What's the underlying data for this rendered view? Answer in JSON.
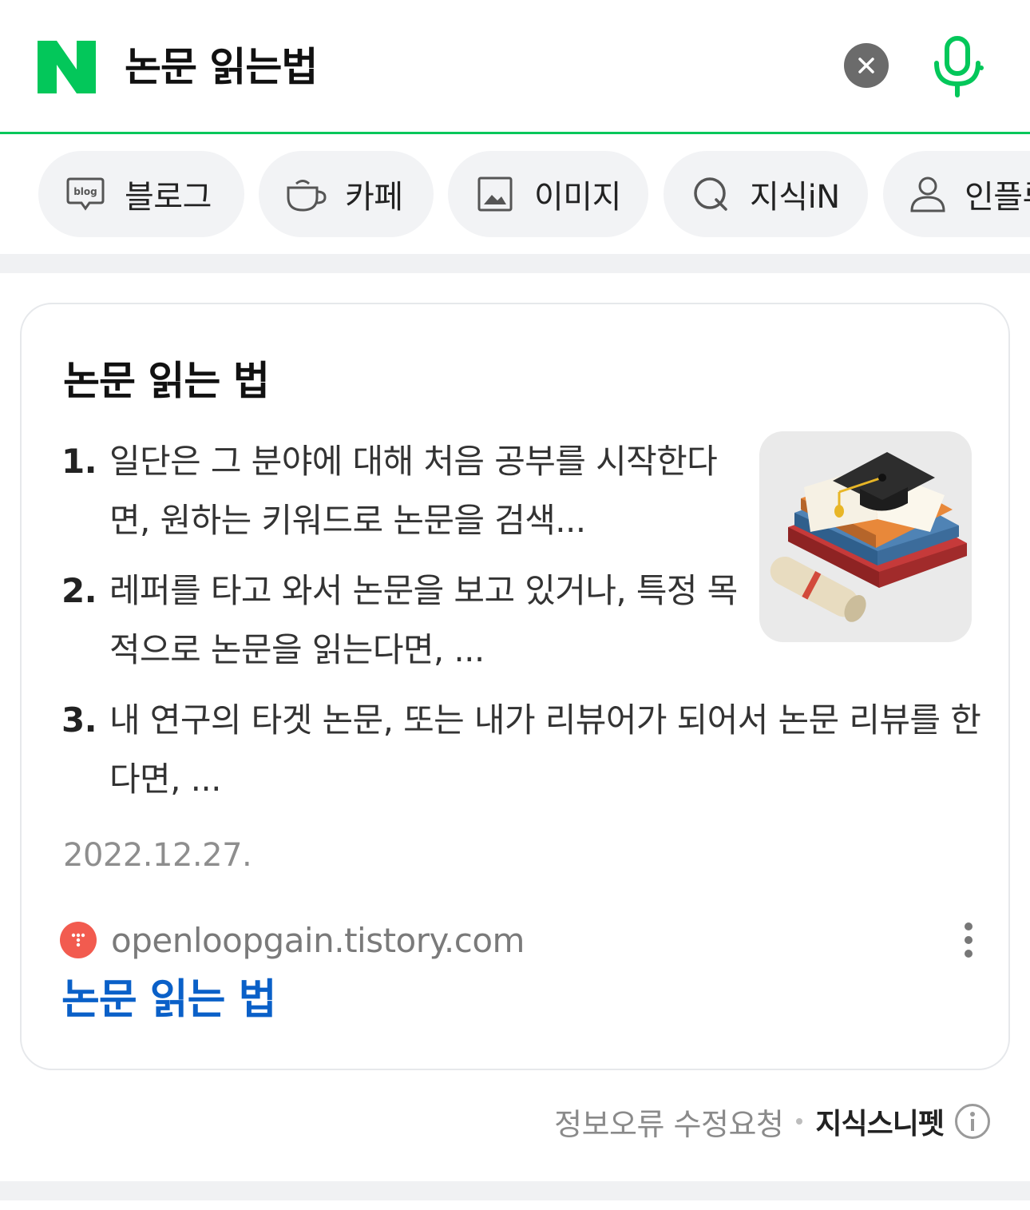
{
  "search": {
    "query": "논문 읽는법"
  },
  "tabs": [
    {
      "label": "블로그",
      "icon": "blog-icon"
    },
    {
      "label": "카페",
      "icon": "cup-icon"
    },
    {
      "label": "이미지",
      "icon": "image-icon"
    },
    {
      "label": "지식iN",
      "icon": "q-icon"
    },
    {
      "label": "인플루언서",
      "icon": "person-icon"
    }
  ],
  "card": {
    "title": "논문 읽는 법",
    "items": [
      {
        "num": "1.",
        "text": "일단은 그 분야에 대해 처음 공부를 시작한다면, 원하는 키워드로 논문을 검색..."
      },
      {
        "num": "2.",
        "text": "레퍼를 타고 와서 논문을 보고 있거나, 특정 목적으로 논문을 읽는다면, ..."
      },
      {
        "num": "3.",
        "text": "내 연구의 타겟 논문, 또는 내가 리뷰어가 되어서 논문 리뷰를 한다면, ..."
      }
    ],
    "date": "2022.12.27.",
    "source": "openloopgain.tistory.com",
    "link_title": "논문 읽는 법"
  },
  "footer": {
    "report": "정보오류 수정요청",
    "brand": "지식스니펫"
  },
  "colors": {
    "naver_green": "#03c75a",
    "link_blue": "#0a60c8",
    "tistory_red": "#f25b4f"
  }
}
